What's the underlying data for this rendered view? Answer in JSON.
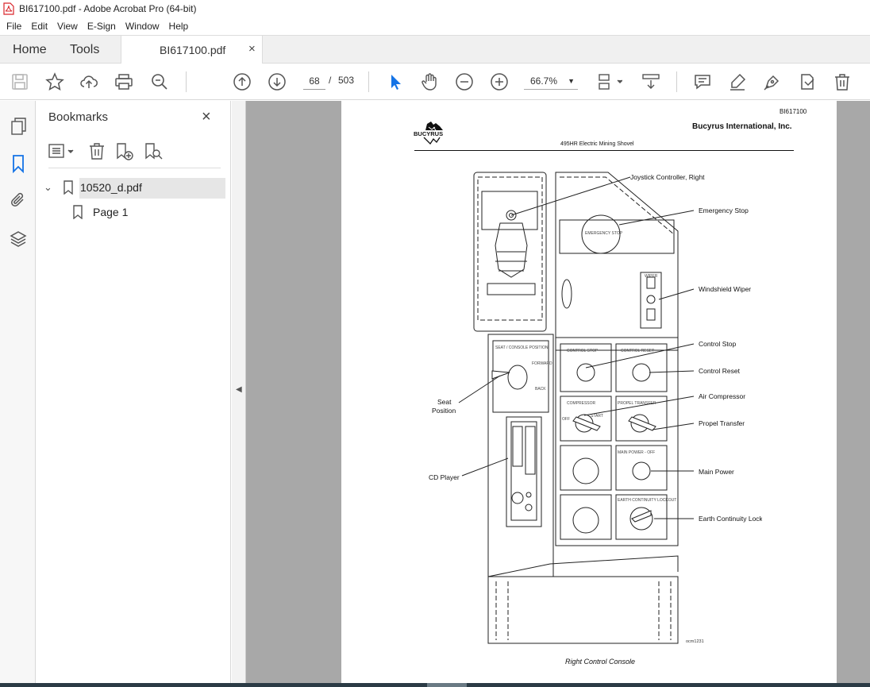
{
  "window": {
    "title": "BI617100.pdf - Adobe Acrobat Pro (64-bit)",
    "app_icon": "pdf-icon",
    "brand_color": "#d9242a"
  },
  "menu": [
    "File",
    "Edit",
    "View",
    "E-Sign",
    "Window",
    "Help"
  ],
  "tabs": {
    "home": "Home",
    "tools": "Tools",
    "doc": "BI617100.pdf",
    "close": "×"
  },
  "toolbar": {
    "current_page": "68",
    "page_sep": "/",
    "page_total": "503",
    "zoom": "66.7%",
    "icons": [
      "save-icon",
      "star-icon",
      "upload-icon",
      "print-icon",
      "zoom-search-icon",
      "prev-page-icon",
      "next-page-icon",
      "select-arrow-icon",
      "hand-icon",
      "zoom-out-icon",
      "zoom-in-icon",
      "fit-page-icon",
      "scroll-mode-icon",
      "comment-icon",
      "highlight-icon",
      "sign-icon",
      "fill-sign-icon",
      "delete-icon"
    ]
  },
  "sidebar": {
    "title": "Bookmarks",
    "close": "×",
    "items": [
      {
        "label": "10520_d.pdf",
        "expanded": true
      },
      {
        "label": "Page 1"
      }
    ]
  },
  "document": {
    "doc_id": "BI617100",
    "company": "Bucyrus International, Inc.",
    "logo_text": "BUCYRUS",
    "subtitle": "495HR Electric Mining Shovel",
    "caption": "Right Control Console",
    "figure_code": "ocm1231",
    "callouts": {
      "joystick": "Joystick Controller, Right",
      "estop": "Emergency Stop",
      "wiper": "Windshield Wiper",
      "control_stop": "Control Stop",
      "control_reset": "Control Reset",
      "air_compressor": "Air Compressor",
      "propel_transfer": "Propel Transfer",
      "main_power": "Main Power",
      "earth": "Earth Continuity Lockout",
      "seat_1": "Seat",
      "seat_2": "Position",
      "cd": "CD Player"
    },
    "panel_labels": {
      "estop_button": "EMERGENCY STOP",
      "control_stop": "CONTROL STOP",
      "control_reset": "CONTROL RESET",
      "compressor": "COMPRESSOR",
      "propel_transfer": "PROPEL TRANSFER",
      "main_power": "MAIN POWER - OFF",
      "earth": "EARTH CONTINUITY LOCKOUT",
      "seat_console": "SEAT / CONSOLE POSITION",
      "wiper": "WIPER",
      "off": "OFF",
      "start": "START",
      "forward": "FORWARD",
      "back": "BACK"
    }
  }
}
